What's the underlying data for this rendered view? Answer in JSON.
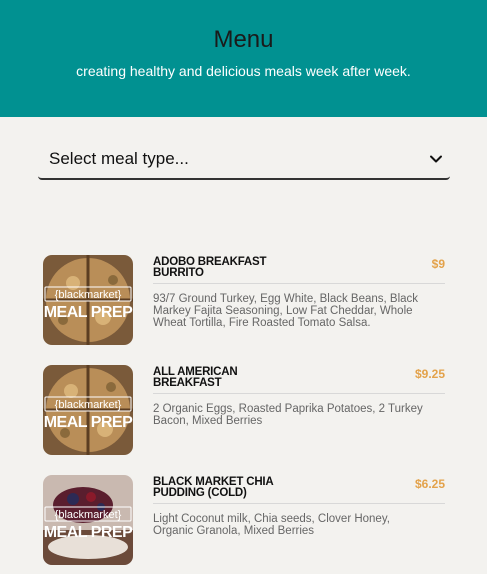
{
  "header": {
    "title": "Menu",
    "subtitle": "creating healthy and delicious meals week after week."
  },
  "filter": {
    "selected": "Select meal type...",
    "icon": "chevron-down-icon"
  },
  "thumbnail": {
    "logo_top": "{blackmarket}",
    "logo_bottom": "MEAL PREP"
  },
  "items": [
    {
      "name": "ADOBO BREAKFAST BURRITO",
      "price": "$9",
      "description": "93/7 Ground Turkey, Egg White, Black Beans, Black Markey Fajita Seasoning, Low Fat Cheddar, Whole Wheat Tortilla, Fire Roasted Tomato Salsa."
    },
    {
      "name": "ALL AMERICAN BREAKFAST",
      "price": "$9.25",
      "description": "2 Organic Eggs, Roasted Paprika Potatoes, 2 Turkey Bacon, Mixed Berries"
    },
    {
      "name": "BLACK MARKET CHIA PUDDING (COLD)",
      "price": "$6.25",
      "description": "Light Coconut milk, Chia seeds, Clover Honey, Organic Granola, Mixed Berries"
    }
  ],
  "colors": {
    "header_bg": "#019191",
    "price": "#e3a24a",
    "page_bg": "#f3f2ef"
  }
}
